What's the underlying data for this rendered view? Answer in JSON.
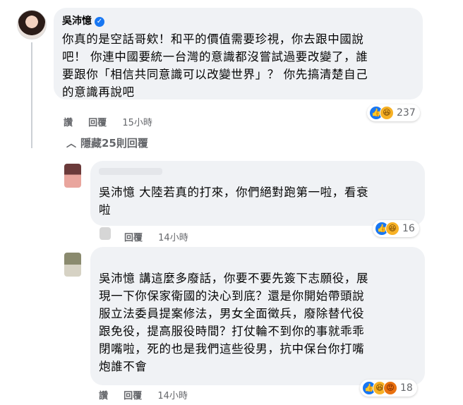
{
  "comments": [
    {
      "author": "吳沛憶",
      "verified": true,
      "lines": [
        "你真的是空話哥欸！和平的價值需要珍視，你去跟中國說",
        "吧！ 你連中國要統一台灣的意識都沒嘗試過要改變了，誰",
        "要跟你「相信共同意識可以改變世界」？ 你先搞清楚自己",
        "的意識再說吧"
      ],
      "actions": [
        "讚",
        "回覆"
      ],
      "time": "15小時",
      "reaction_count": "237",
      "reactions": [
        "like-icon",
        "haha-icon"
      ]
    },
    {
      "lines": [
        "吳沛憶 大陸若真的打來，你們絕對跑第一啦，看衰",
        "啦"
      ],
      "actions": [
        "讚",
        "回覆"
      ],
      "time": "14小時",
      "reaction_count": "16",
      "reactions": [
        "like-icon",
        "haha-icon"
      ]
    },
    {
      "lines": [
        "吳沛憶 講這麼多廢話，你要不要先簽下志願役，展",
        "現一下你保家衛國的決心到底？還是你開始帶頭說",
        "服立法委員提案修法，男女全面徵兵，廢除替代役",
        "跟免役，提高服役時間？打仗輪不到你的事就乖乖",
        "閉嘴啦，死的也是我們這些役男，抗中保台你打嘴",
        "炮誰不會"
      ],
      "actions": [
        "讚",
        "回覆"
      ],
      "time": "14小時",
      "reaction_count": "18",
      "reactions": [
        "like-icon",
        "haha-icon",
        "angry-icon"
      ]
    }
  ],
  "hide_replies": "隱藏25則回覆",
  "hide_chevron": "︿",
  "icons": {
    "like": "👍",
    "haha": "😆",
    "angry": "😡",
    "verified": "✓"
  },
  "colors": {
    "bubble": "#f0f2f5",
    "secondary_text": "#65676b",
    "link_blue": "#1877f2"
  }
}
